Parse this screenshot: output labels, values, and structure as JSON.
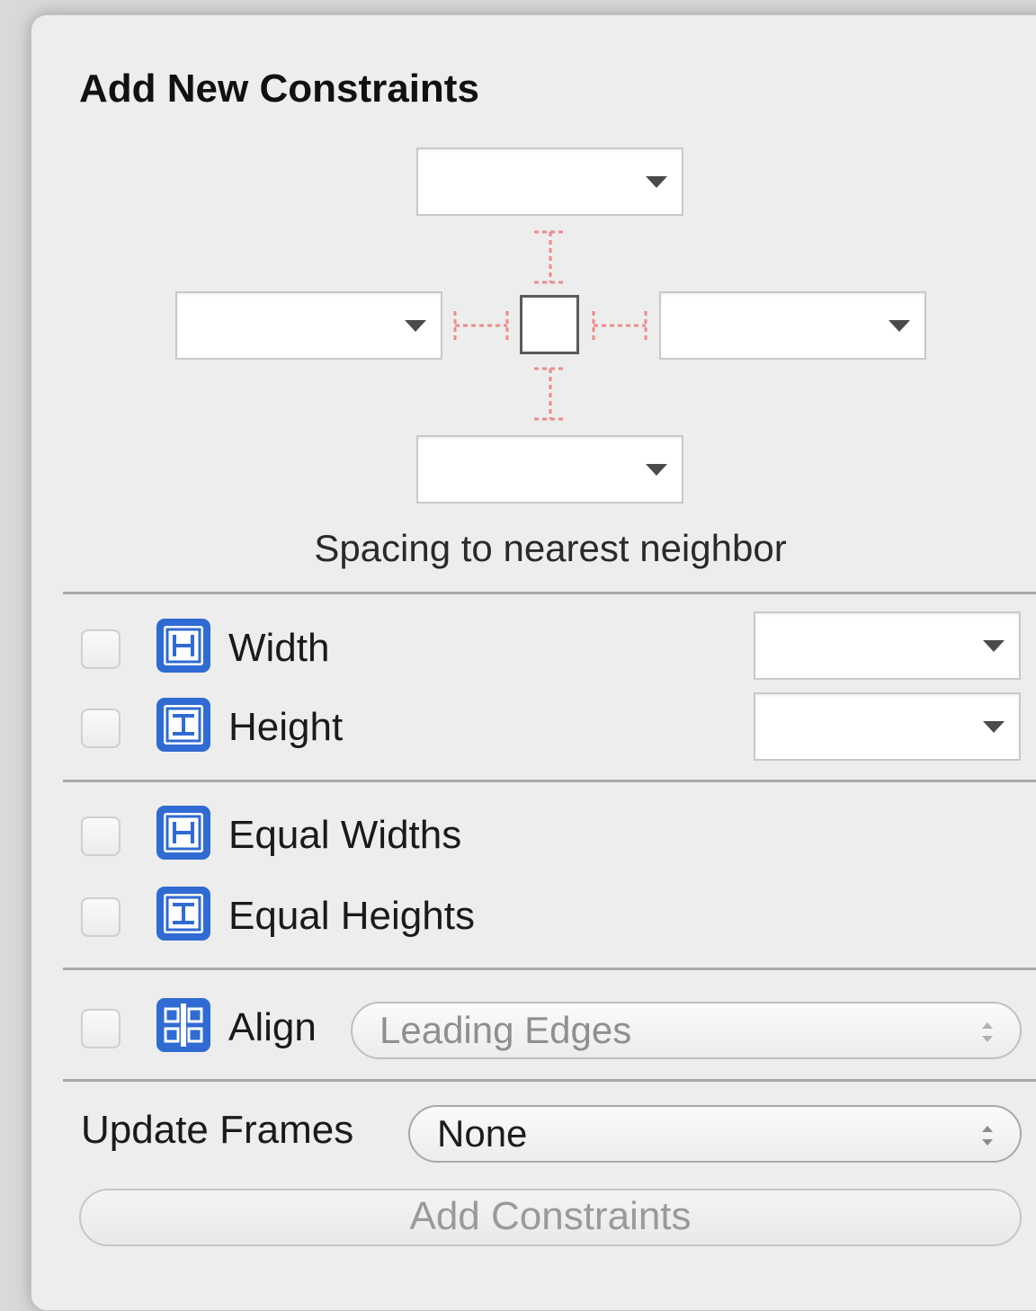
{
  "title": "Add New Constraints",
  "spacing": {
    "top_value": "",
    "left_value": "",
    "right_value": "",
    "bottom_value": "",
    "caption": "Spacing to nearest neighbor"
  },
  "size": {
    "width_label": "Width",
    "width_value": "",
    "height_label": "Height",
    "height_value": ""
  },
  "equal": {
    "widths_label": "Equal Widths",
    "heights_label": "Equal Heights"
  },
  "align": {
    "label": "Align",
    "selected": "Leading Edges"
  },
  "update_frames": {
    "label": "Update Frames",
    "selected": "None"
  },
  "add_button_label": "Add Constraints",
  "icons": {
    "width": "width-constraint-icon",
    "height": "height-constraint-icon",
    "align": "align-icon",
    "popup": "updown-chevron-icon"
  },
  "colors": {
    "icon_blue": "#2f6bd2",
    "strut_red": "#f08a8a",
    "separator": "#a9a9a9"
  }
}
